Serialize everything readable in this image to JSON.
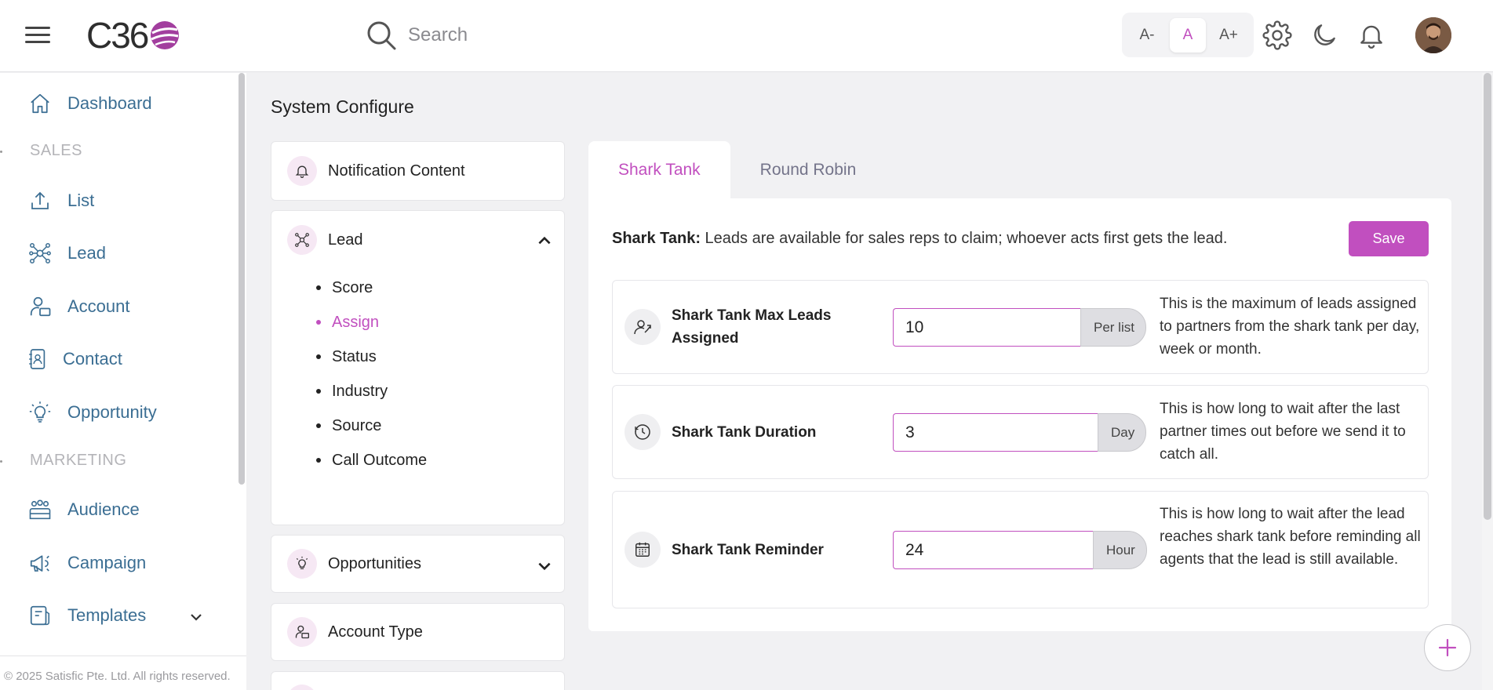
{
  "header": {
    "logo_text": "C36",
    "search_placeholder": "Search",
    "font_sizes": [
      "A-",
      "A",
      "A+"
    ],
    "active_font_size": "A",
    "icons": [
      "menu-icon",
      "search-icon",
      "gear-icon",
      "moon-icon",
      "bell-icon"
    ]
  },
  "sidebar": {
    "dashboard": "Dashboard",
    "section_sales": "SALES",
    "list": "List",
    "lead": "Lead",
    "account": "Account",
    "contact": "Contact",
    "opportunity": "Opportunity",
    "section_marketing": "MARKETING",
    "audience": "Audience",
    "campaign": "Campaign",
    "templates": "Templates",
    "footer": "© 2025 Satisfic Pte. Ltd. All rights reserved."
  },
  "main": {
    "title": "System Configure",
    "config_menu": {
      "notification_content": "Notification Content",
      "lead": "Lead",
      "lead_items": [
        "Score",
        "Assign",
        "Status",
        "Industry",
        "Source",
        "Call Outcome"
      ],
      "active_lead_item": "Assign",
      "opportunities": "Opportunities",
      "account_type": "Account Type"
    },
    "tabs": [
      "Shark Tank",
      "Round Robin"
    ],
    "active_tab": "Shark Tank",
    "desc_bold": "Shark Tank:",
    "desc_text": " Leads are available for sales reps to claim; whoever acts first gets the lead.",
    "save_label": "Save",
    "settings": [
      {
        "label": "Shark Tank Max Leads Assigned",
        "value": "10",
        "unit": "Per list",
        "help": "This is the maximum of leads assigned to partners from the shark tank per day, week or month."
      },
      {
        "label": "Shark Tank Duration",
        "value": "3",
        "unit": "Day",
        "help": "This is how long to wait after the last partner times out before we send it to catch all."
      },
      {
        "label": "Shark Tank Reminder",
        "value": "24",
        "unit": "Hour",
        "help": "This is how long to wait after the lead reaches shark tank before reminding all agents that the lead is still available."
      }
    ]
  },
  "colors": {
    "accent": "#c14fbf",
    "nav_text": "#3b6e93",
    "section_text": "#b4b4b8"
  }
}
